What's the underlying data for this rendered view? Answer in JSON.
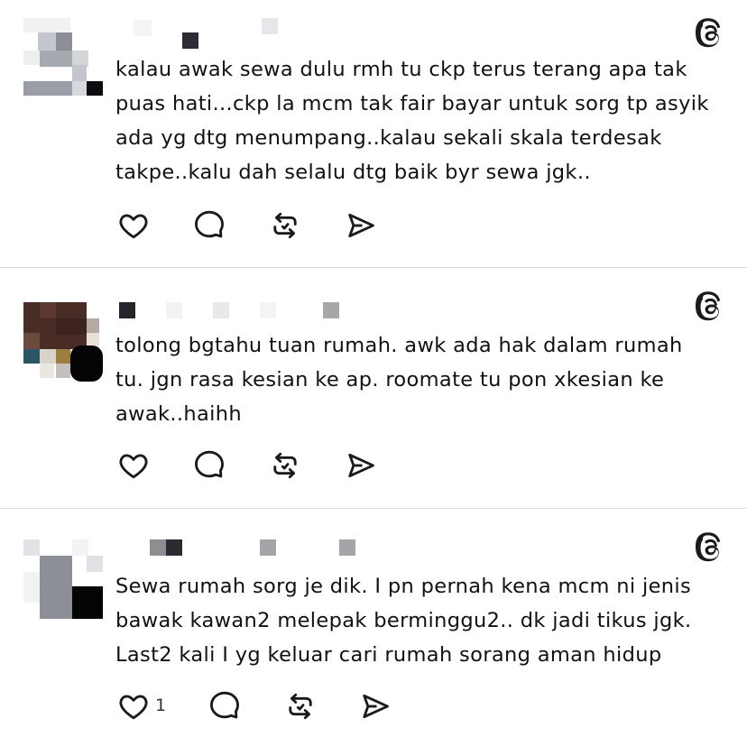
{
  "posts": [
    {
      "text": "kalau awak sewa dulu rmh tu ckp terus terang apa tak\npuas hati...ckp la mcm tak fair bayar untuk sorg tp asyik\nada yg dtg menumpang..kalau sekali skala terdesak\ntakpe..kalu dah selalu dtg baik byr sewa jgk..",
      "like_count": ""
    },
    {
      "text": "tolong bgtahu tuan rumah. awk ada hak dalam rumah\ntu. jgn rasa kesian ke ap. roomate tu pon xkesian ke\nawak..haihh",
      "like_count": ""
    },
    {
      "text": "Sewa rumah sorg je dik. I pn pernah kena mcm ni jenis\nbawak kawan2 melepak berminggu2.. dk jadi tikus jgk.\nLast2 kali I yg keluar cari rumah sorang aman hidup",
      "like_count": "1"
    }
  ],
  "icons": {
    "like": "heart-icon",
    "reply": "comment-icon",
    "repost": "repost-icon",
    "share": "share-icon",
    "brand": "threads-logo-icon"
  },
  "colors": {
    "text": "#111111",
    "divider": "#dcdcdc",
    "icon": "#1a1a1a"
  }
}
